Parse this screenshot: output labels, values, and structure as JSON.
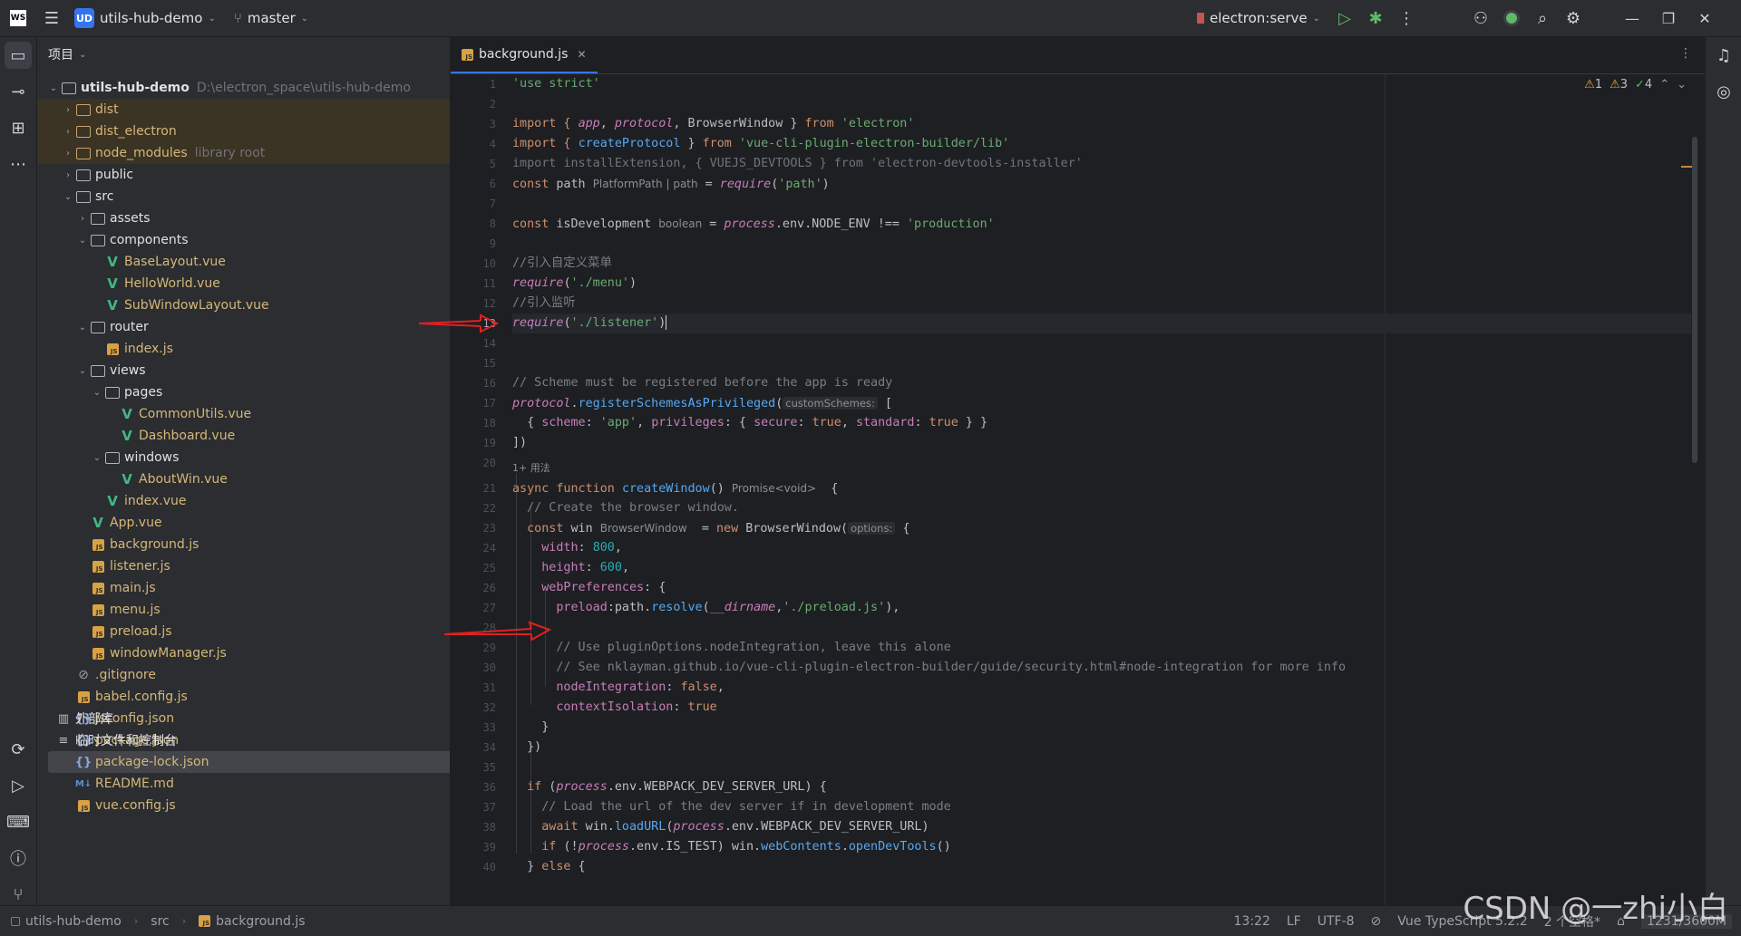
{
  "titlebar": {
    "app_logo": "WS",
    "project_badge": "UD",
    "project_name": "utils-hub-demo",
    "branch": "master",
    "run_config": "electron:serve"
  },
  "project_panel": {
    "title": "项目",
    "root_name": "utils-hub-demo",
    "root_path": "D:\\electron_space\\utils-hub-demo",
    "items": [
      {
        "label": "dist",
        "kind": "folder",
        "arrow": "›",
        "hl": true
      },
      {
        "label": "dist_electron",
        "kind": "folder",
        "arrow": "›",
        "hl": true
      },
      {
        "label": "node_modules",
        "kind": "folder",
        "arrow": "›",
        "hint": "library root",
        "hl": true
      },
      {
        "label": "public",
        "kind": "folder",
        "arrow": "›"
      },
      {
        "label": "src",
        "kind": "folder",
        "arrow": "⌄"
      },
      {
        "label": "assets",
        "kind": "folder",
        "arrow": "›"
      },
      {
        "label": "components",
        "kind": "folder",
        "arrow": "⌄"
      },
      {
        "label": "BaseLayout.vue",
        "kind": "vue"
      },
      {
        "label": "HelloWorld.vue",
        "kind": "vue"
      },
      {
        "label": "SubWindowLayout.vue",
        "kind": "vue"
      },
      {
        "label": "router",
        "kind": "folder",
        "arrow": "⌄"
      },
      {
        "label": "index.js",
        "kind": "js"
      },
      {
        "label": "views",
        "kind": "folder",
        "arrow": "⌄"
      },
      {
        "label": "pages",
        "kind": "folder",
        "arrow": "⌄"
      },
      {
        "label": "CommonUtils.vue",
        "kind": "vue"
      },
      {
        "label": "Dashboard.vue",
        "kind": "vue"
      },
      {
        "label": "windows",
        "kind": "folder",
        "arrow": "⌄"
      },
      {
        "label": "AboutWin.vue",
        "kind": "vue"
      },
      {
        "label": "index.vue",
        "kind": "vue"
      },
      {
        "label": "App.vue",
        "kind": "vue"
      },
      {
        "label": "background.js",
        "kind": "js"
      },
      {
        "label": "listener.js",
        "kind": "js"
      },
      {
        "label": "main.js",
        "kind": "js"
      },
      {
        "label": "menu.js",
        "kind": "js"
      },
      {
        "label": "preload.js",
        "kind": "js"
      },
      {
        "label": "windowManager.js",
        "kind": "js"
      },
      {
        "label": ".gitignore",
        "kind": "git"
      },
      {
        "label": "babel.config.js",
        "kind": "js"
      },
      {
        "label": "jsconfig.json",
        "kind": "json"
      },
      {
        "label": "package.json",
        "kind": "json"
      },
      {
        "label": "package-lock.json",
        "kind": "json",
        "sel": true
      },
      {
        "label": "README.md",
        "kind": "md"
      },
      {
        "label": "vue.config.js",
        "kind": "js"
      }
    ],
    "external_libs": "外部库",
    "scratches": "临时文件和控制台"
  },
  "editor": {
    "tab_label": "background.js",
    "inspections": {
      "warnings": "1",
      "weak_warnings": "3",
      "ok": "4"
    },
    "code_vision_hint": "1+ 用法",
    "line_numbers": [
      "1",
      "2",
      "3",
      "4",
      "5",
      "6",
      "7",
      "8",
      "9",
      "10",
      "11",
      "12",
      "13",
      "14",
      "15",
      "16",
      "17",
      "18",
      "19",
      "20",
      "21",
      "22",
      "23",
      "24",
      "25",
      "26",
      "27",
      "28",
      "29",
      "30",
      "31",
      "32",
      "33",
      "34",
      "35",
      "36",
      "37",
      "38",
      "39",
      "40"
    ],
    "hints": {
      "path_type": "PlatformPath | path",
      "isdev_type": "boolean",
      "custom_schemes": "customSchemes:",
      "promise_type": "Promise<void>",
      "win_type": "BrowserWindow",
      "options": "options:"
    },
    "lines": {
      "l1": "'use strict'",
      "l3a": "import { ",
      "l3b": "app",
      "l3c": ", ",
      "l3d": "protocol",
      "l3e": ", BrowserWindow } ",
      "l3f": "from",
      "l3g": " 'electron'",
      "l4a": "import { ",
      "l4b": "createProtocol",
      "l4c": " } ",
      "l4d": "from",
      "l4e": " 'vue-cli-plugin-electron-builder/lib'",
      "l5": "import installExtension, { VUEJS_DEVTOOLS } from 'electron-devtools-installer'",
      "l6a": "const",
      "l6b": " path ",
      "l6c": " = ",
      "l6d": "require",
      "l6e": "(",
      "l6f": "'path'",
      "l6g": ")",
      "l8a": "const",
      "l8b": " isDevelopment ",
      "l8c": " = ",
      "l8d": "process",
      "l8e": ".env.NODE_ENV !== ",
      "l8f": "'production'",
      "l10": "//引入自定义菜单",
      "l11a": "require",
      "l11b": "(",
      "l11c": "'./menu'",
      "l11d": ")",
      "l12": "//引入监听",
      "l13a": "require",
      "l13b": "(",
      "l13c": "'./listener'",
      "l13d": ")",
      "l16": "// Scheme must be registered before the app is ready",
      "l17a": "protocol",
      "l17b": ".",
      "l17c": "registerSchemesAsPrivileged",
      "l17d": "(",
      "l17e": " [",
      "l18a": "  { ",
      "l18b": "scheme",
      "l18c": ": ",
      "l18d": "'app'",
      "l18e": ", ",
      "l18f": "privileges",
      "l18g": ": { ",
      "l18h": "secure",
      "l18i": ": ",
      "l18j": "true",
      "l18k": ", ",
      "l18l": "standard",
      "l18m": ": ",
      "l18n": "true",
      "l18o": " } }",
      "l19": "])",
      "l21a": "async function",
      "l21b": " ",
      "l21c": "createWindow",
      "l21d": "() ",
      "l21e": "  {",
      "l22": "  // Create the browser window.",
      "l23a": "  const",
      "l23b": " win ",
      "l23c": "  = ",
      "l23d": "new",
      "l23e": " BrowserWindow(",
      "l23f": " {",
      "l24a": "    width",
      "l24b": ": ",
      "l24c": "800",
      "l24d": ",",
      "l25a": "    height",
      "l25b": ": ",
      "l25c": "600",
      "l25d": ",",
      "l26a": "    webPreferences",
      "l26b": ": {",
      "l27a": "      preload",
      "l27b": ":path.",
      "l27c": "resolve",
      "l27d": "(",
      "l27e": "__dirname",
      "l27f": ",",
      "l27g": "'./preload.js'",
      "l27h": "),",
      "l29": "      // Use pluginOptions.nodeIntegration, leave this alone",
      "l30": "      // See nklayman.github.io/vue-cli-plugin-electron-builder/guide/security.html#node-integration for more info",
      "l31a": "      nodeIntegration",
      "l31b": ": ",
      "l31c": "false",
      "l31d": ",",
      "l32a": "      contextIsolation",
      "l32b": ": ",
      "l32c": "true",
      "l33": "    }",
      "l34": "  })",
      "l36a": "  if",
      "l36b": " (",
      "l36c": "process",
      "l36d": ".env.WEBPACK_DEV_SERVER_URL) {",
      "l37": "    // Load the url of the dev server if in development mode",
      "l38a": "    await",
      "l38b": " win.",
      "l38c": "loadURL",
      "l38d": "(",
      "l38e": "process",
      "l38f": ".env.WEBPACK_DEV_SERVER_URL)",
      "l39a": "    if",
      "l39b": " (!",
      "l39c": "process",
      "l39d": ".env.IS_TEST) win.",
      "l39e": "webContents",
      "l39f": ".",
      "l39g": "openDevTools",
      "l39h": "()",
      "l40a": "  } ",
      "l40b": "else",
      "l40c": " {"
    }
  },
  "statusbar": {
    "crumb_project": "utils-hub-demo",
    "crumb_src": "src",
    "crumb_file": "background.js",
    "position": "13:22",
    "line_sep": "LF",
    "encoding": "UTF-8",
    "language": "Vue TypeScript 5.2.2",
    "indent": "2 个空格*",
    "memory": "1231/3600M"
  },
  "watermark": "CSDN @一zhi小白",
  "colors": {
    "accent": "#3574f0",
    "vue": "#41b883",
    "js": "#d8a243",
    "annotation_arrow": "#e02020"
  }
}
